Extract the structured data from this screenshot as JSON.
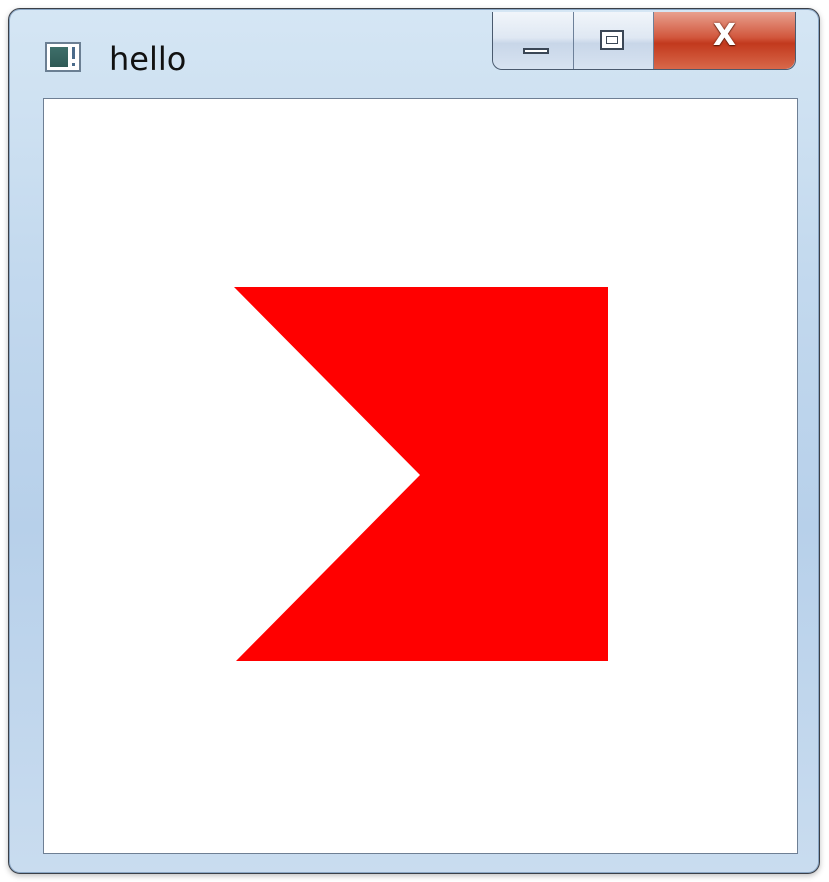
{
  "window": {
    "title": "hello",
    "close_symbol": "X"
  },
  "icons": {
    "app": "app-window-icon",
    "minimize": "minimize-icon",
    "maximize": "maximize-icon",
    "close": "close-icon"
  },
  "colors": {
    "shape_fill": "#ff0000",
    "client_background": "#ffffff",
    "close_button": "#c7402a"
  }
}
